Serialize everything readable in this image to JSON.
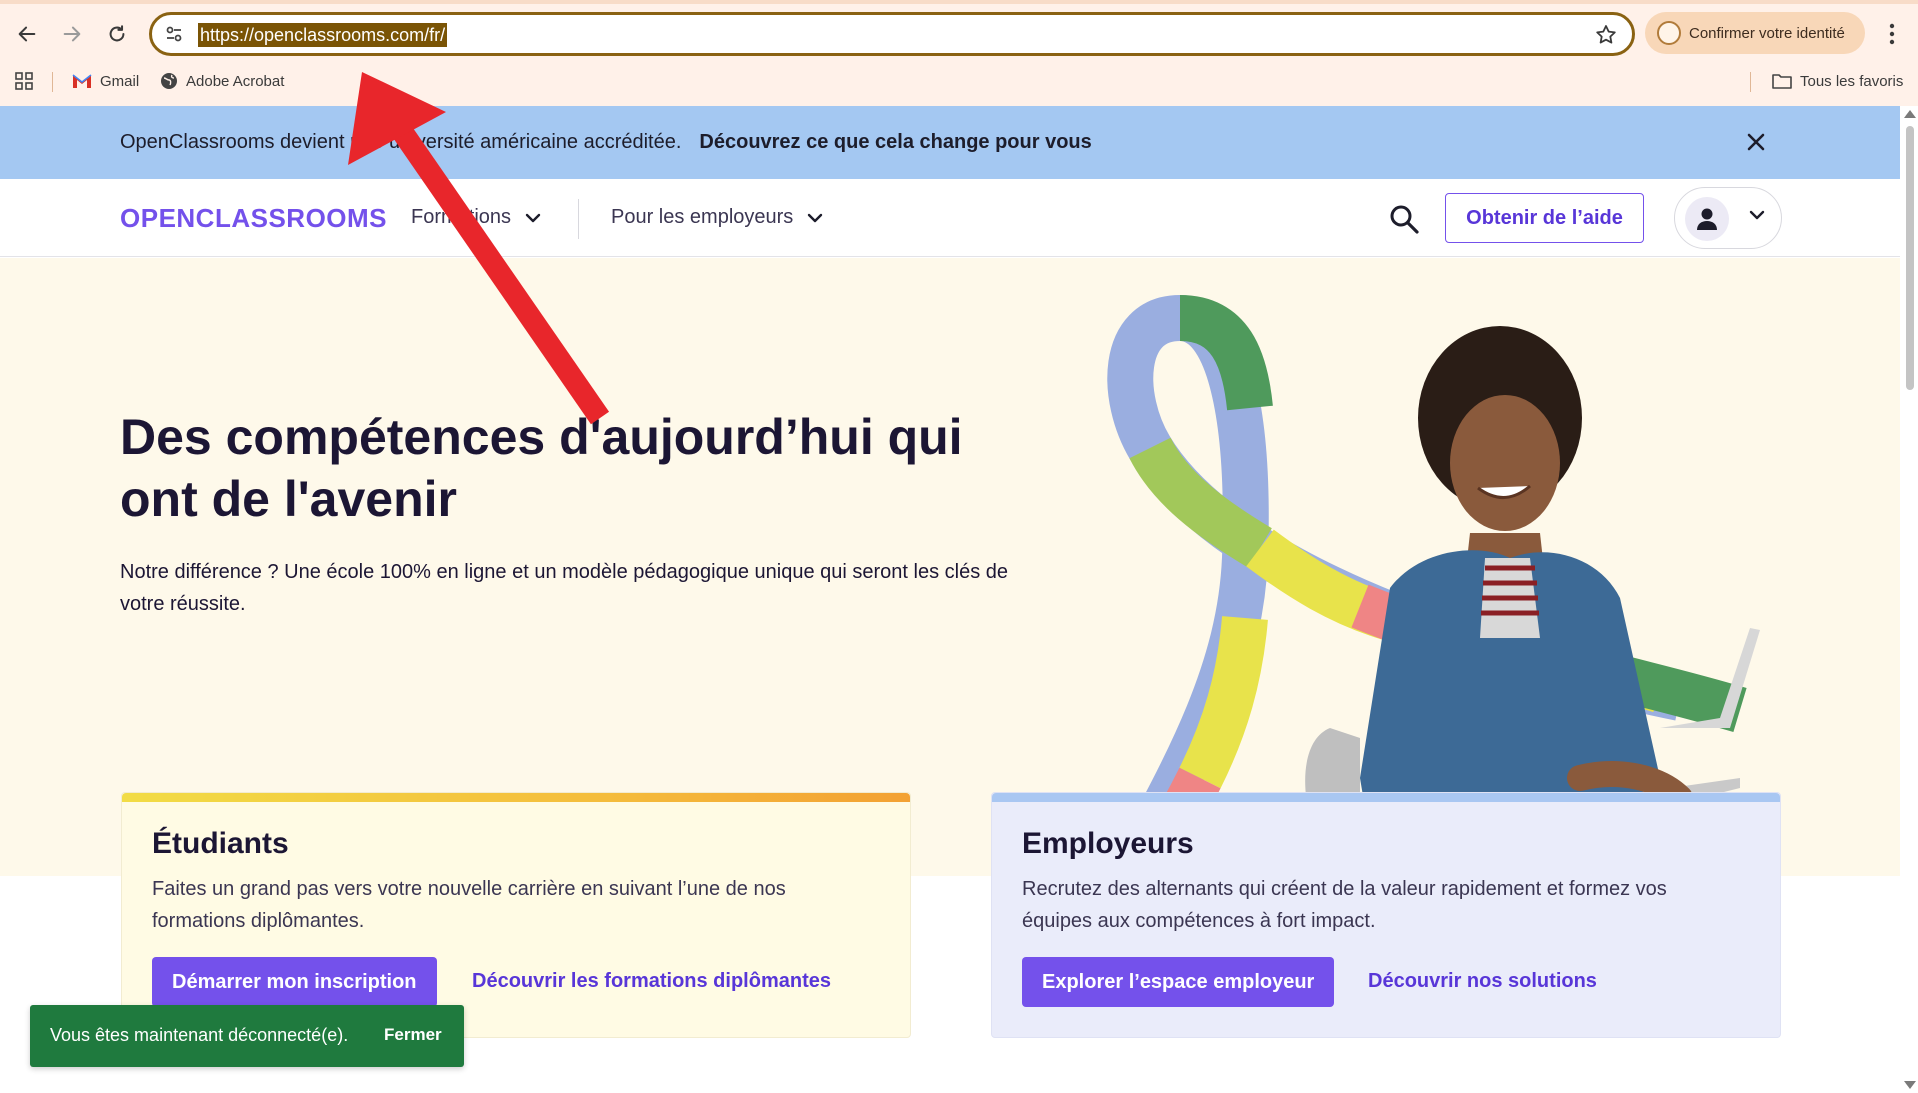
{
  "browser": {
    "url": "https://openclassrooms.com/fr/",
    "identity_button": "Confirmer votre identité",
    "bookmarks": [
      {
        "label": "Gmail",
        "icon": "gmail-icon"
      },
      {
        "label": "Adobe Acrobat",
        "icon": "globe-icon"
      }
    ],
    "all_favorites": "Tous les favoris"
  },
  "banner": {
    "text": "OpenClassrooms devient une université américaine accréditée.",
    "link": "Découvrez ce que cela change pour vous"
  },
  "header": {
    "logo": "OPENCLASSROOMS",
    "nav": [
      "Formations",
      "Pour les employeurs"
    ],
    "help_button": "Obtenir de l’aide"
  },
  "hero": {
    "title": "Des compétences d'aujourd’hui qui ont de l'avenir",
    "subtitle": "Notre différence ? Une école 100% en ligne et un modèle pédagogique unique qui seront les clés de votre réussite."
  },
  "cards": {
    "students": {
      "title": "Étudiants",
      "text": "Faites un grand pas vers votre nouvelle carrière en suivant l’une de nos formations diplômantes.",
      "primary": "Démarrer mon inscription",
      "link": "Découvrir les formations diplômantes"
    },
    "employers": {
      "title": "Employeurs",
      "text": "Recrutez des alternants qui créent de la valeur rapidement et formez vos équipes aux compétences à fort impact.",
      "primary": "Explorer l’espace employeur",
      "link": "Découvrir nos solutions"
    }
  },
  "toast": {
    "message": "Vous êtes maintenant déconnecté(e).",
    "close": "Fermer"
  },
  "colors": {
    "brand": "#7451eb",
    "banner": "#a4c8f2",
    "hero_bg": "#fef9ea",
    "toast": "#1f7a3e",
    "annotation_arrow": "#e8262b"
  }
}
